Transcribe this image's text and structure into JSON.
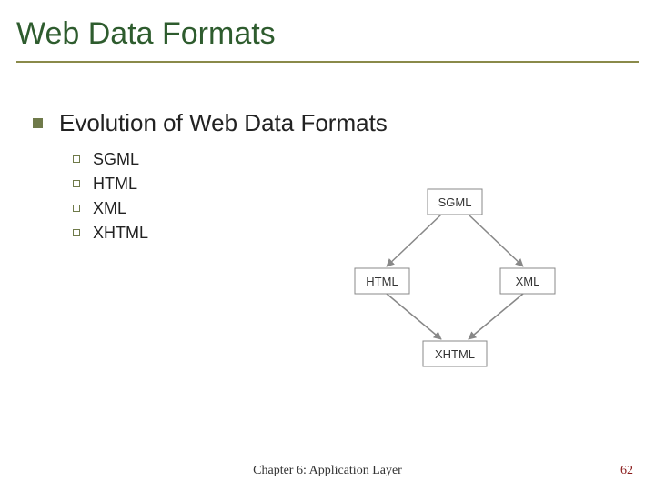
{
  "title": "Web Data Formats",
  "heading": "Evolution of Web Data Formats",
  "items": [
    "SGML",
    "HTML",
    "XML",
    "XHTML"
  ],
  "diagram": {
    "top": "SGML",
    "left": "HTML",
    "right": "XML",
    "bottom": "XHTML"
  },
  "footer": {
    "center": "Chapter 6: Application Layer",
    "page": "62"
  }
}
